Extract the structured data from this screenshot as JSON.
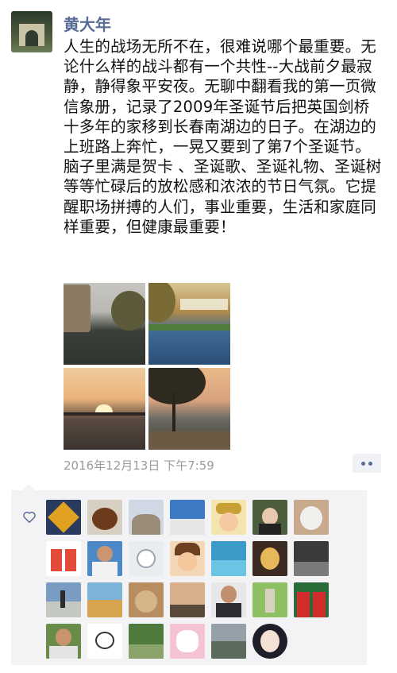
{
  "post": {
    "author": "黄大年",
    "content": "人生的战场无所不在，很难说哪个最重要。无论什么样的战斗都有一个共性--大战前夕最寂静，静得象平安夜。无聊中翻看我的第一页微信象册，记录了2009年圣诞节后把英国剑桥十多年的家移到长春南湖边的日子。在湖边的上班路上奔忙，一晃又要到了第7个圣诞节。脑子里满是贺卡 、圣诞歌、圣诞礼物、圣诞树等等忙碌后的放松感和浓浓的节日气氛。它提醒职场拼搏的人们，事业重要，生活和家庭同样重要，但健康最重要！",
    "timestamp": "2016年12月13日 下午7:59"
  },
  "photos": [
    {
      "name": "river-building-photo"
    },
    {
      "name": "river-bridge-photo"
    },
    {
      "name": "lake-sunset-photo"
    },
    {
      "name": "lakeside-tree-photo"
    }
  ],
  "icons": {
    "more": "more-dots-icon",
    "like": "heart-icon"
  },
  "colors": {
    "nickname": "#576b95",
    "timestamp": "#9b9b9b",
    "likes_panel": "#f3f3f5"
  },
  "likers_count": 25
}
